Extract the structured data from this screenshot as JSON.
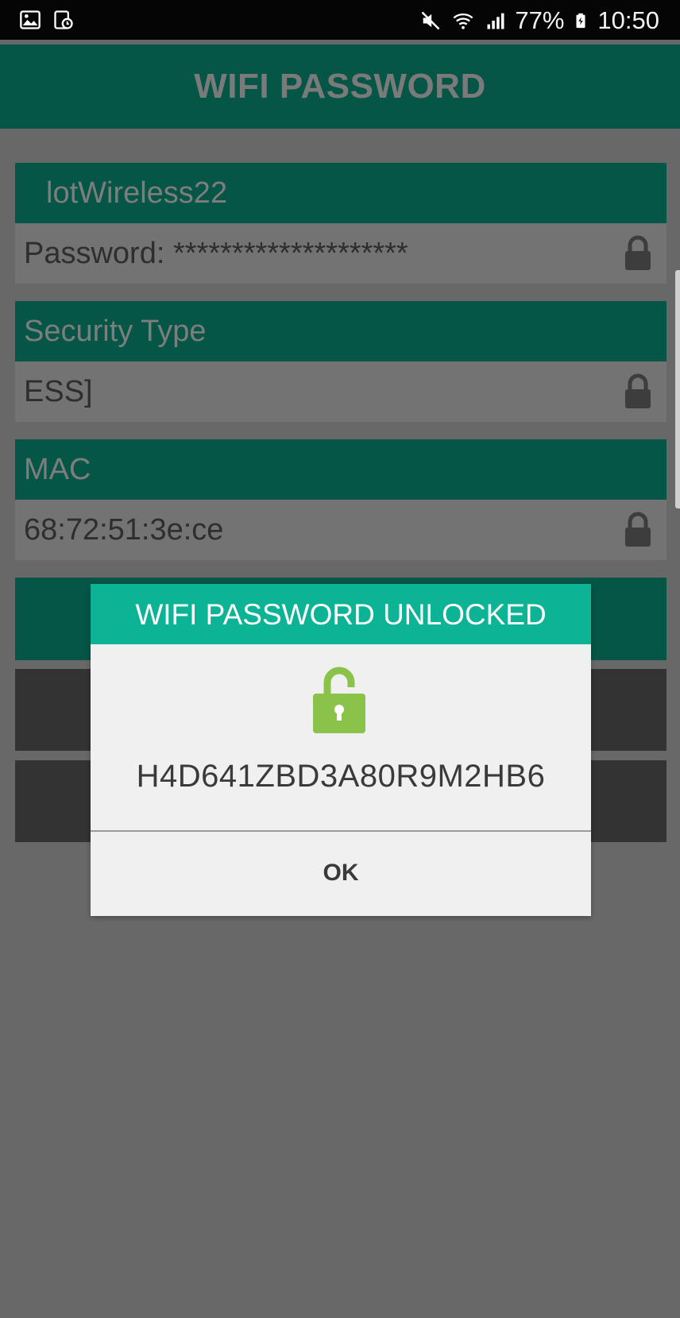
{
  "status_bar": {
    "battery": "77%",
    "time": "10:50",
    "icons": [
      "image-icon",
      "calendar-clock-icon",
      "mute-icon",
      "wifi-icon",
      "signal-icon",
      "battery-icon"
    ]
  },
  "app_bar": {
    "title": "WIFI PASSWORD"
  },
  "network": {
    "ssid": "lotWireless22",
    "password_row": "Password: ********************"
  },
  "security": {
    "header": "Security Type",
    "value": "ESS]"
  },
  "mac": {
    "header": "MAC",
    "value": "68:72:51:3e:ce"
  },
  "dialog": {
    "title": "WIFI PASSWORD UNLOCKED",
    "password": "H4D641ZBD3A80R9M2HB6",
    "ok_label": "OK"
  },
  "colors": {
    "app_bar": "#055646",
    "dialog_header": "#0db395",
    "unlock_icon": "#8bc34a",
    "overlay": "#686868"
  }
}
